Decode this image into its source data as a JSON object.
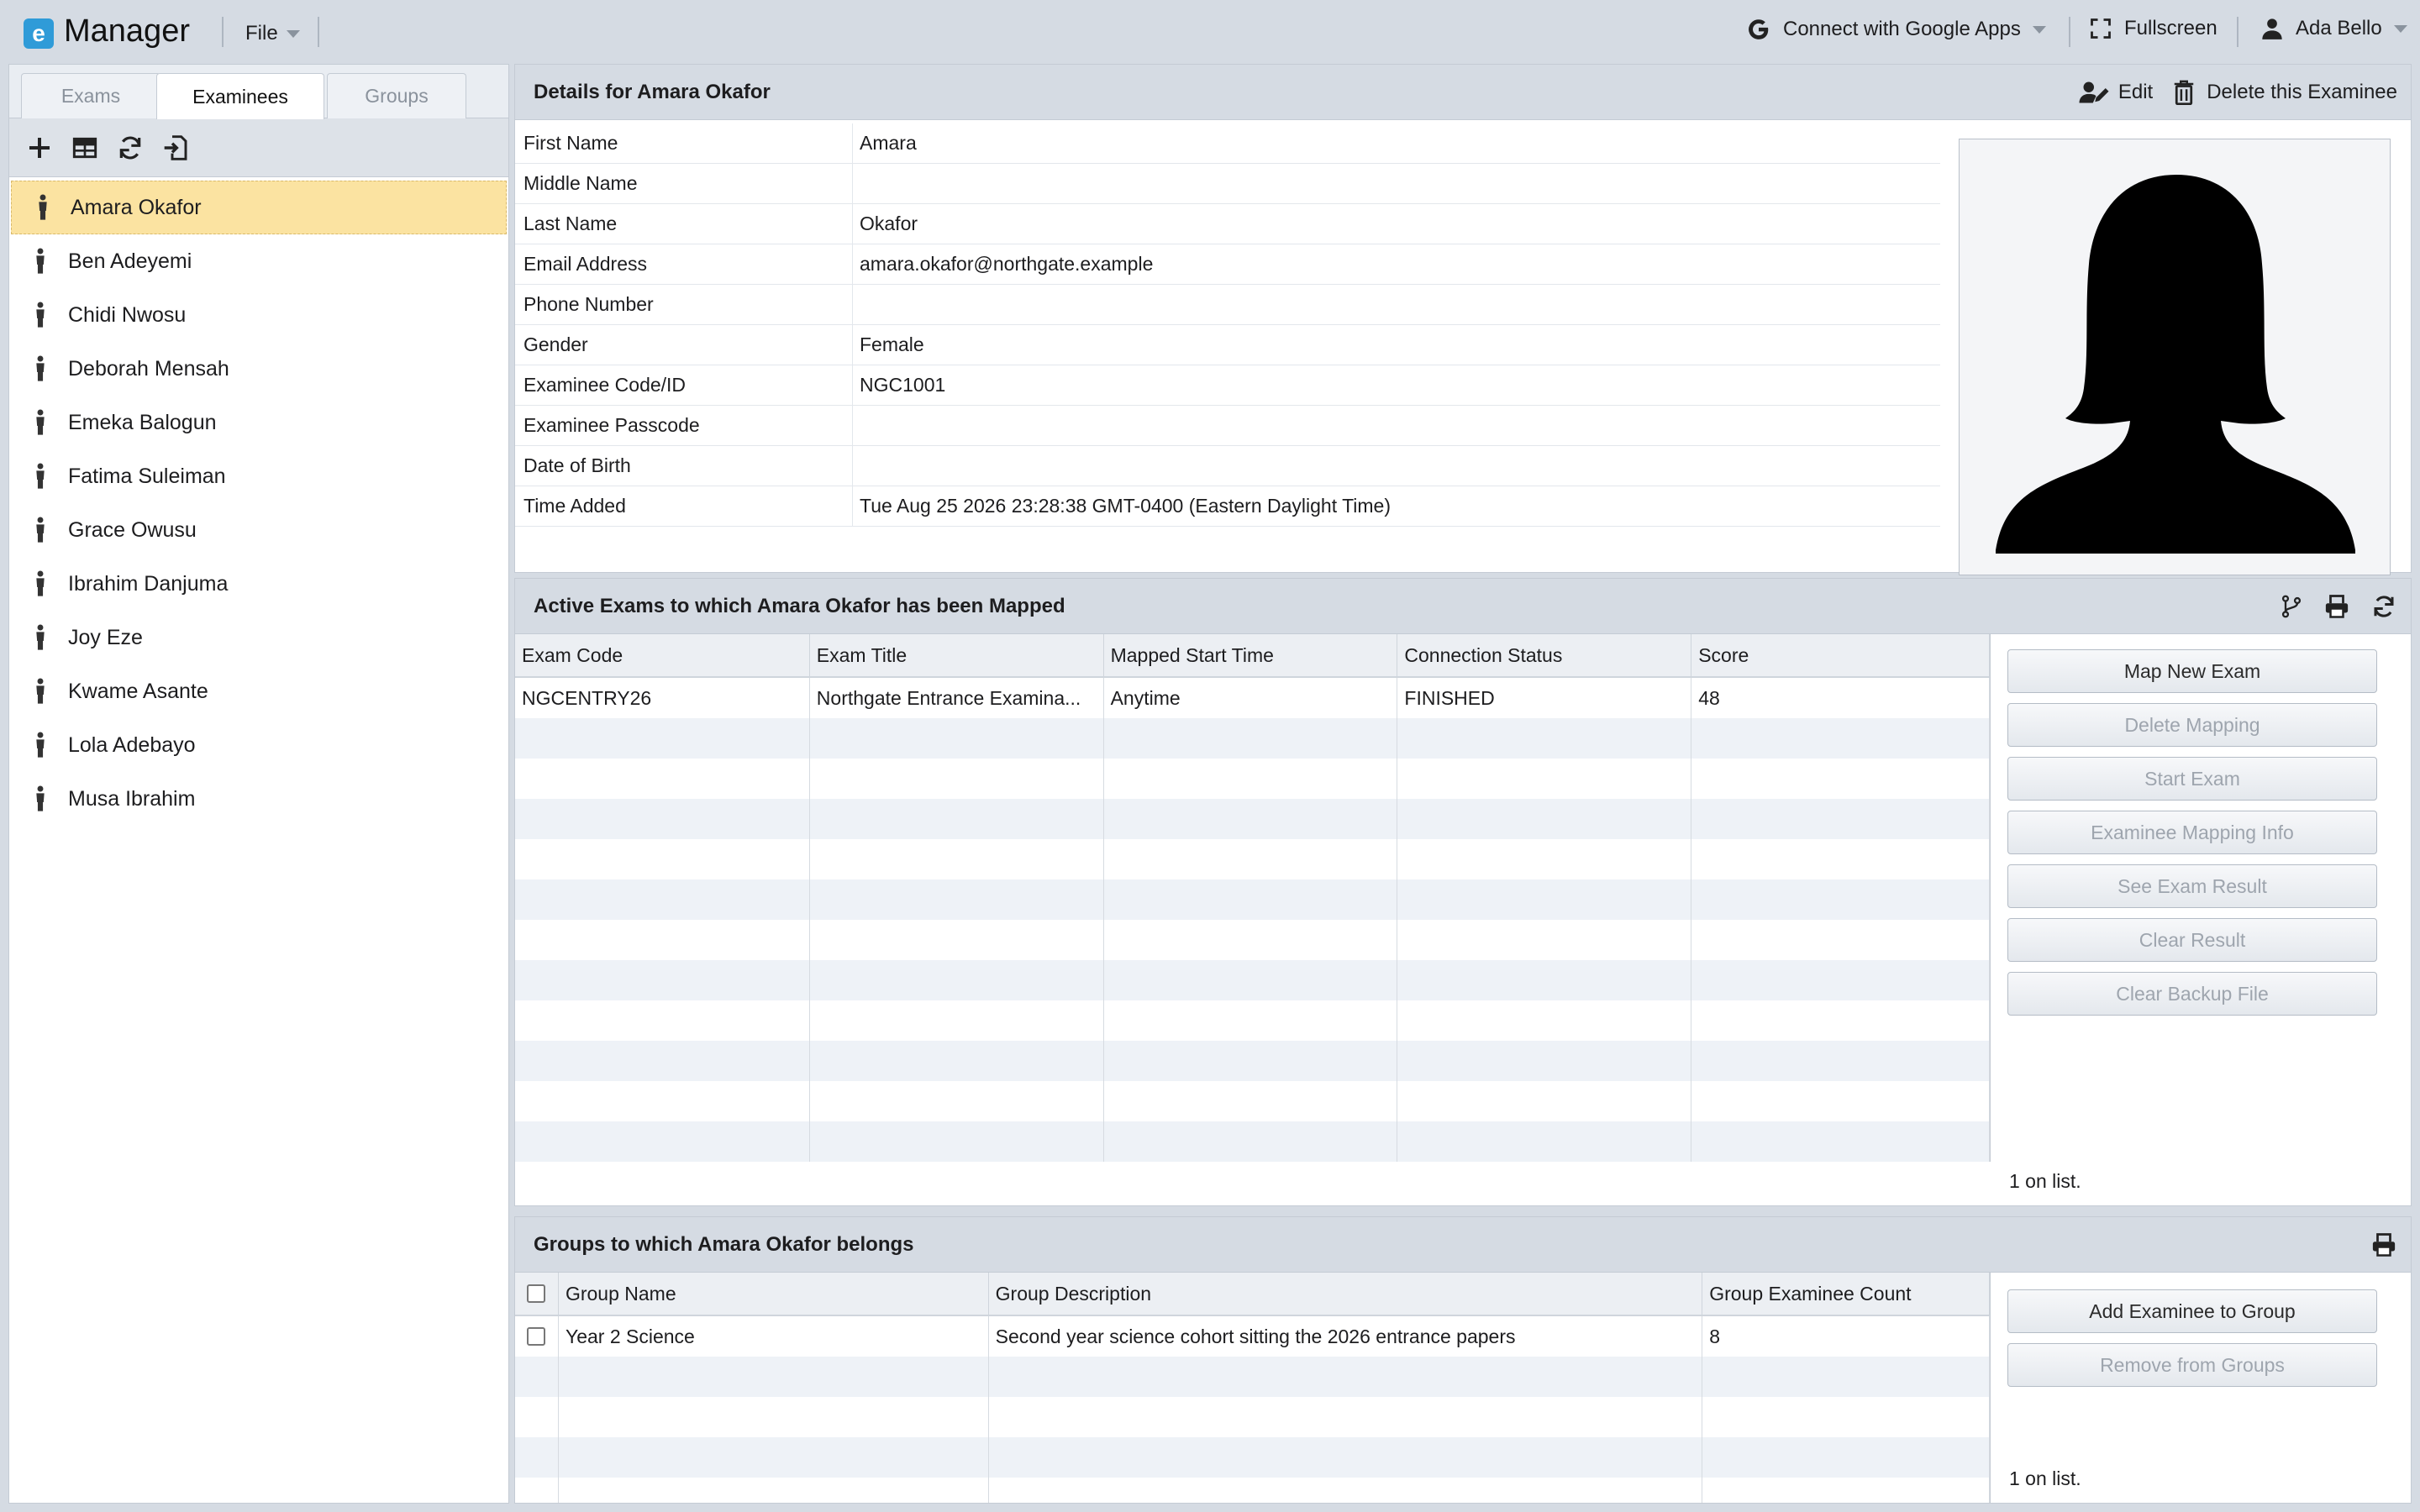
{
  "app": {
    "logo_letter": "e",
    "title": "Manager"
  },
  "menu": {
    "file_label": "File"
  },
  "topbar": {
    "connect_label": "Connect with Google Apps",
    "fullscreen_label": "Fullscreen",
    "user_name": "Ada Bello"
  },
  "left": {
    "tabs": [
      "Exams",
      "Examinees",
      "Groups"
    ],
    "active_tab": "Examinees",
    "toolbar_icons": [
      "plus-icon",
      "table-icon",
      "refresh-icon",
      "import-icon"
    ],
    "examinees": [
      "Amara Okafor",
      "Ben Adeyemi",
      "Chidi Nwosu",
      "Deborah Mensah",
      "Emeka Balogun",
      "Fatima Suleiman",
      "Grace Owusu",
      "Ibrahim Danjuma",
      "Joy Eze",
      "Kwame Asante",
      "Lola Adebayo",
      "Musa Ibrahim"
    ],
    "selected": "Amara Okafor"
  },
  "details": {
    "header": "Details for Amara Okafor",
    "edit_label": "Edit",
    "delete_label": "Delete this Examinee",
    "rows": [
      {
        "label": "First Name",
        "value": "Amara"
      },
      {
        "label": "Middle Name",
        "value": ""
      },
      {
        "label": "Last Name",
        "value": "Okafor"
      },
      {
        "label": "Email Address",
        "value": "amara.okafor@northgate.example"
      },
      {
        "label": "Phone Number",
        "value": ""
      },
      {
        "label": "Gender",
        "value": "Female"
      },
      {
        "label": "Examinee Code/ID",
        "value": "NGC1001"
      },
      {
        "label": "Examinee Passcode",
        "value": ""
      },
      {
        "label": "Date of Birth",
        "value": ""
      },
      {
        "label": "Time Added",
        "value": "Tue Aug 25 2026 23:28:38 GMT-0400 (Eastern Daylight Time)"
      }
    ]
  },
  "exams": {
    "header": "Active Exams to which Amara Okafor has been Mapped",
    "columns": [
      "Exam Code",
      "Exam Title",
      "Mapped Start Time",
      "Connection Status",
      "Score"
    ],
    "rows": [
      [
        "NGCENTRY26",
        "Northgate Entrance Examina...",
        "Anytime",
        "FINISHED",
        "48"
      ]
    ],
    "buttons": [
      {
        "label": "Map New Exam",
        "enabled": true
      },
      {
        "label": "Delete Mapping",
        "enabled": false
      },
      {
        "label": "Start Exam",
        "enabled": false
      },
      {
        "label": "Examinee Mapping Info",
        "enabled": false
      },
      {
        "label": "See Exam Result",
        "enabled": false
      },
      {
        "label": "Clear Result",
        "enabled": false
      },
      {
        "label": "Clear Backup File",
        "enabled": false
      }
    ],
    "count_label": "1 on list."
  },
  "groups": {
    "header": "Groups to which Amara Okafor belongs",
    "columns": [
      "Group Name",
      "Group Description",
      "Group Examinee Count"
    ],
    "rows": [
      [
        "Year 2 Science",
        "Second year science cohort sitting the 2026 entrance papers",
        "8"
      ]
    ],
    "buttons": [
      {
        "label": "Add Examinee to Group",
        "enabled": true
      },
      {
        "label": "Remove from Groups",
        "enabled": false
      }
    ],
    "count_label": "1 on list."
  },
  "colors": {
    "accent": "#2f9bd8",
    "selected_row": "#fbe3a1",
    "header_bg": "#d5dbe3"
  }
}
